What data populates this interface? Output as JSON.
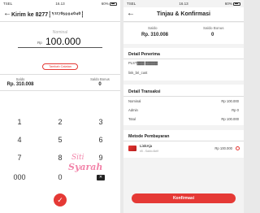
{
  "left": {
    "status": {
      "carrier": "TSEL",
      "time": "16.13",
      "battery": "60%"
    },
    "header": {
      "back": "←",
      "title": "Kirim ke 8277┆ʼʳ¹²⁷⁰ˢ⁸⁸⁴⁰⁴⁰┆"
    },
    "amount": {
      "label": "Nominal",
      "currency": "Rp",
      "value": "100.000"
    },
    "note_button": "Tambah Catatan",
    "saldo": {
      "label": "Saldo",
      "value": "Rp. 310.008"
    },
    "saldo_bonus": {
      "label": "Saldo Bonus",
      "value": "0"
    },
    "keys": [
      "1",
      "2",
      "3",
      "4",
      "5",
      "6",
      "7",
      "8",
      "9",
      "000",
      "0"
    ],
    "delete_icon": "backspace-icon",
    "ok_icon": "check-icon",
    "watermark": {
      "line1": "Siti",
      "line2": "Syarah"
    }
  },
  "right": {
    "status": {
      "carrier": "TSEL",
      "time": "16.13",
      "battery": "60%"
    },
    "header": {
      "back": "←",
      "title": "Tinjau & Konfirmasi"
    },
    "saldo": {
      "label": "Saldo",
      "value": "Rp. 310.008"
    },
    "saldo_bonus": {
      "label": "Saldo Bonus",
      "value": "0"
    },
    "penerima": {
      "title": "Detail Penerima",
      "name": "PLST▓▓▓ ▓▓▓▓▓",
      "note": "link_bri_cust"
    },
    "transaksi": {
      "title": "Detail Transaksi",
      "rows": [
        {
          "label": "Nominal",
          "value": "Rp 100.000"
        },
        {
          "label": "Admin",
          "value": "Rp 0"
        },
        {
          "label": "Total",
          "value": "Rp 100.000"
        }
      ]
    },
    "pembayaran": {
      "title": "Metode Pembayaran",
      "method": "LinkAja",
      "sub": "#5 - Saldo Aktif",
      "value": "Rp 100.000"
    },
    "confirm_button": "Konfirmasi"
  },
  "colors": {
    "accent": "#e53935",
    "text": "#222222",
    "muted": "#666666"
  }
}
